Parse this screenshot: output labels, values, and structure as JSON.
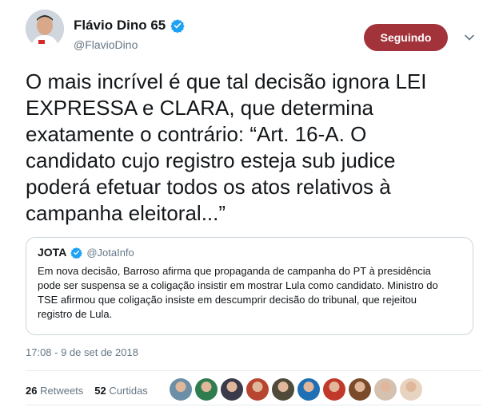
{
  "tweet": {
    "display_name": "Flávio Dino 65",
    "handle": "@FlavioDino",
    "follow_label": "Seguindo",
    "text": "O mais incrível é que tal decisão ignora LEI\nEXPRESSA e CLARA, que determina\nexatamente o contrário: “Art. 16-A.  O\ncandidato cujo registro esteja sub judice\npoderá efetuar todos os atos relativos à\ncampanha eleitoral...”",
    "timestamp": "17:08 - 9 de set de 2018"
  },
  "quoted": {
    "name": "JOTA",
    "handle": "@JotaInfo",
    "text": "Em nova decisão, Barroso afirma que propaganda de campanha do PT à presidência\npode ser suspensa se a coligação insistir em mostrar Lula como candidato. Ministro do\nTSE afirmou que coligação insiste em descumprir decisão do tribunal, que rejeitou\nregistro de Lula."
  },
  "stats": {
    "retweets_count": "26",
    "retweets_label": "Retweets",
    "likes_count": "52",
    "likes_label": "Curtidas"
  },
  "colors": {
    "follow_button": "#a3333a",
    "verified": "#1da1f2",
    "text": "#14171a",
    "secondary": "#657786"
  },
  "liker_avatars": [
    "#6b8fa6",
    "#2f7d4f",
    "#3a3a4a",
    "#b8452f",
    "#4f4a3a",
    "#1f6fb5",
    "#c0392b",
    "#7a4a2a",
    "#d4c1b0",
    "#e8d3c0"
  ]
}
